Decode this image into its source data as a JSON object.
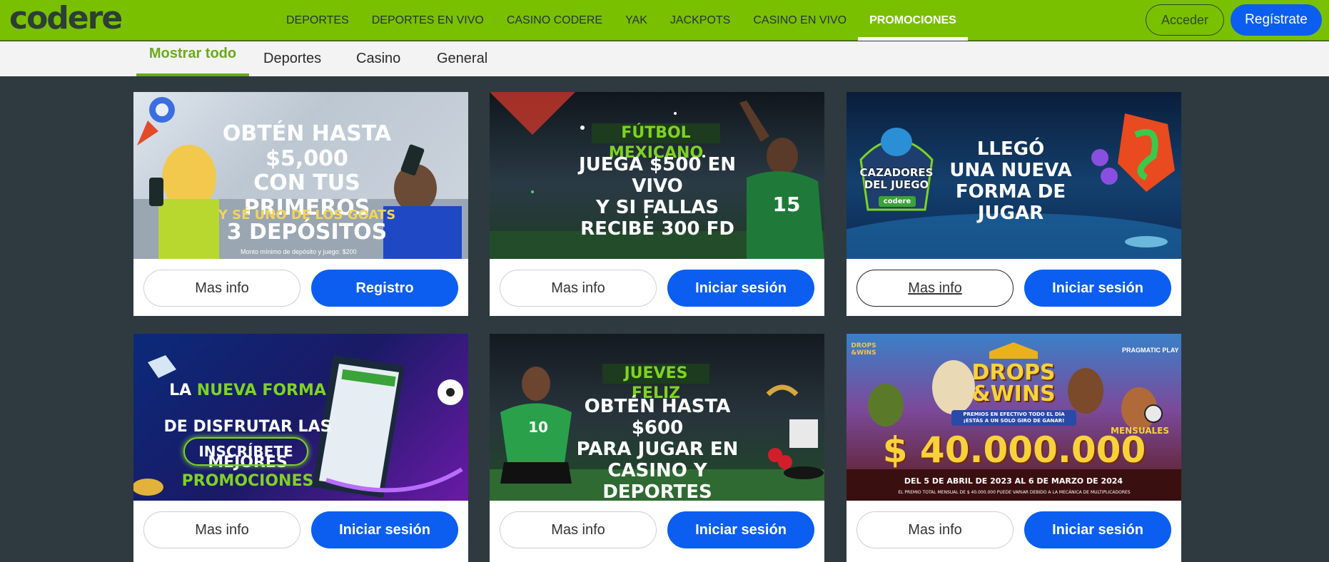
{
  "logo": "codere",
  "nav": [
    "DEPORTES",
    "DEPORTES EN VIVO",
    "CASINO CODERE",
    "YAK",
    "JACKPOTS",
    "CASINO EN VIVO",
    "PROMOCIONES"
  ],
  "auth": {
    "login": "Acceder",
    "register": "Regístrate"
  },
  "tabs": [
    "Mostrar todo",
    "Deportes",
    "Casino",
    "General"
  ],
  "colors": {
    "brand_green": "#79c000",
    "primary_blue": "#0b5ef0",
    "page_bg": "#2e3a40"
  },
  "cards": [
    {
      "info": "Mas info",
      "cta": "Registro",
      "headline": "OBTÉN HASTA $5,000\nCON TUS PRIMEROS\n3 DEPÓSITOS",
      "sub": "Y SÉ UNO DE LOS GOATS",
      "fine": "Monto mínimo de depósito y juego: $200"
    },
    {
      "info": "Mas info",
      "cta": "Iniciar sesión",
      "kicker": "FÚTBOL MEXICANO",
      "headline": "JUEGA $500 EN VIVO\nY SI FALLAS\nRECIBE 300 FD",
      "jersey": "15"
    },
    {
      "info": "Mas info",
      "cta": "Iniciar sesión",
      "badge": "CAZADORES\nDEL JUEGO",
      "badge_brand": "codere",
      "headline": "LLEGÓ\nUNA NUEVA\nFORMA DE JUGAR"
    },
    {
      "info": "Mas info",
      "cta": "Iniciar sesión",
      "headline_lines": [
        {
          "a": "LA ",
          "b": "NUEVA FORMA"
        },
        {
          "a": "DE DISFRUTAR LAS",
          "b": ""
        },
        {
          "a": "MEJORES ",
          "b": "PROMOCIONES"
        }
      ],
      "pill": "INSCRÍBETE"
    },
    {
      "info": "Mas info",
      "cta": "Iniciar sesión",
      "kicker": "JUEVES FELIZ",
      "headline": "OBTÉN HASTA $600\nPARA JUGAR EN\nCASINO Y DEPORTES",
      "jersey": "10"
    },
    {
      "info": "Mas info",
      "cta": "Iniciar sesión",
      "logo_small": "DROPS\n&WINS",
      "provider": "PRAGMATIC PLAY",
      "title": "DROPS\n&WINS",
      "ribbon": "PREMIOS EN EFECTIVO TODO EL DÍA\n¡ESTÁS A UN SOLO GIRO DE GANAR!",
      "monthly": "MENSUALES",
      "amount": "$ 40.000.000",
      "dates": "DEL 5 DE ABRIL DE 2023 AL 6 DE MARZO DE 2024",
      "fine": "EL PREMIO TOTAL MENSUAL DE $ 40.000.000 PUEDE VARIAR DEBIDO A LA MECÁNICA DE MULTIPLICADORES"
    }
  ]
}
